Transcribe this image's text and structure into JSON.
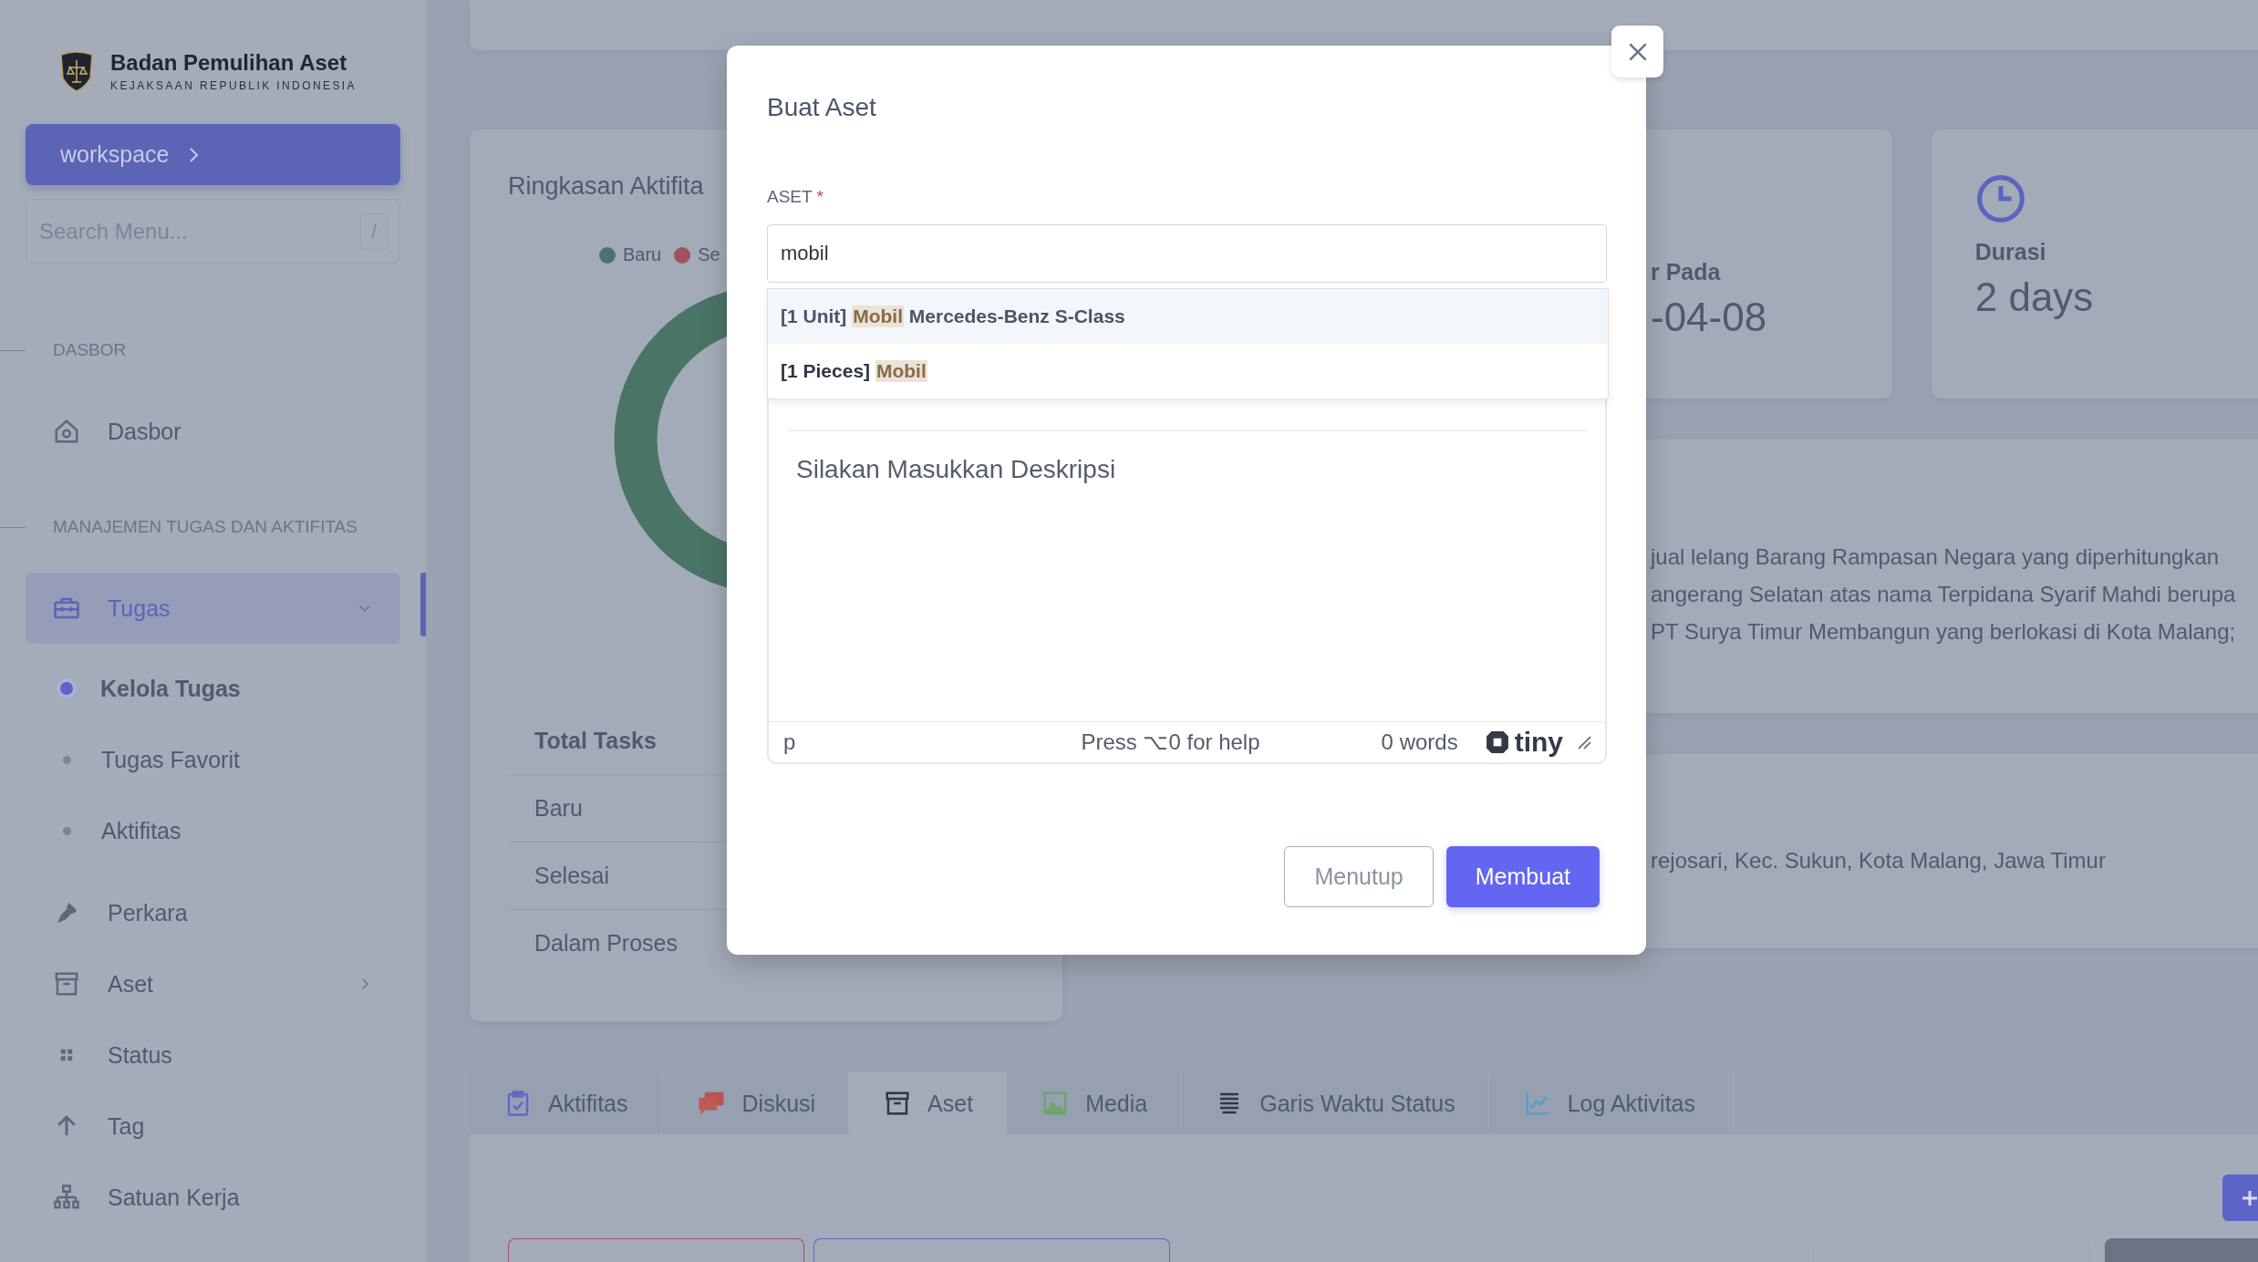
{
  "sidebar": {
    "title": "Badan Pemulihan Aset",
    "subtitle": "KEJAKSAAN REPUBLIK INDONESIA",
    "workspace_button": "workspace",
    "search": {
      "placeholder": "Search Menu...",
      "shortcut": "/"
    },
    "items": [
      {
        "kind": "section",
        "label": "DASBOR"
      },
      {
        "kind": "item",
        "label": "Dasbor",
        "selected": false
      },
      {
        "kind": "section",
        "label": "MANAJEMEN TUGAS DAN AKTIFITAS"
      },
      {
        "kind": "item",
        "label": "Tugas",
        "selected": true,
        "expanded": true,
        "children": [
          {
            "label": "Kelola Tugas",
            "selected": true
          },
          {
            "label": "Tugas Favorit",
            "selected": false
          },
          {
            "label": "Aktifitas",
            "selected": false
          }
        ]
      },
      {
        "kind": "item",
        "label": "Perkara",
        "selected": false
      },
      {
        "kind": "item",
        "label": "Aset",
        "selected": false,
        "expanded": false
      },
      {
        "kind": "item",
        "label": "Status",
        "selected": false
      },
      {
        "kind": "item",
        "label": "Tag",
        "selected": false
      },
      {
        "kind": "item",
        "label": "Satuan Kerja",
        "selected": false
      }
    ]
  },
  "summary": {
    "title": "Ringkasan Aktifita",
    "legend": [
      {
        "label": "Baru",
        "color": "#4a7466"
      },
      {
        "label": "Se",
        "color": "#a3505f"
      }
    ],
    "table_header": "Total Tasks",
    "rows": [
      "Baru",
      "Selesai",
      "Dalam Proses"
    ]
  },
  "stats": [
    {
      "label": "r Pada",
      "value": "-04-08"
    },
    {
      "label": "Durasi",
      "value": "2 days"
    }
  ],
  "description_lines": [
    "jual lelang Barang Rampasan Negara yang diperhitungkan",
    "angerang Selatan atas nama Terpidana Syarif Mahdi berupa",
    "PT Surya Timur Membangun yang berlokasi di Kota Malang;"
  ],
  "address": "rejosari, Kec. Sukun, Kota Malang, Jawa Timur",
  "tabs": [
    {
      "label": "Aktifitas",
      "selected": false
    },
    {
      "label": "Diskusi",
      "selected": false
    },
    {
      "label": "Aset",
      "selected": true
    },
    {
      "label": "Media",
      "selected": false
    },
    {
      "label": "Garis Waktu Status",
      "selected": false
    },
    {
      "label": "Log Aktivitas",
      "selected": false
    }
  ],
  "modal": {
    "title": "Buat Aset",
    "field_label": "ASET",
    "required_mark": "*",
    "value": "mobil",
    "options": [
      {
        "prefix": "[1 Unit]",
        "match": "Mobil",
        "suffix": "Mercedes-Benz S-Class",
        "selected": true
      },
      {
        "prefix": "[1 Pieces]",
        "match": "Mobil",
        "selected": false
      }
    ],
    "editor": {
      "placeholder": "Silakan Masukkan Deskripsi",
      "path": "p",
      "help": "Press ⌥0 for help",
      "word_count": "0 words",
      "brand": "tiny"
    },
    "buttons": [
      {
        "kind": "secondary",
        "label": "Menutup"
      },
      {
        "kind": "primary",
        "label": "Membuat"
      }
    ]
  }
}
